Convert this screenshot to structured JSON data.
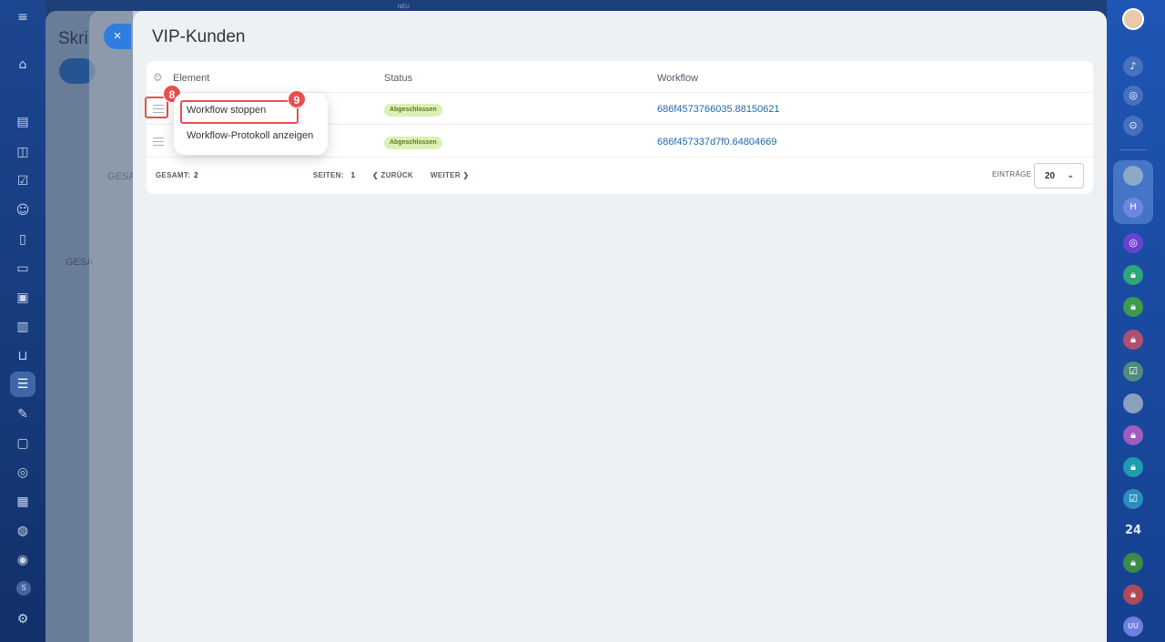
{
  "top_badge": "NEU",
  "left_sidebar": {
    "icons": [
      "menu-icon",
      "home-icon",
      "chat-icon",
      "feed-icon",
      "tasks-icon",
      "contacts-icon",
      "documents-icon",
      "inventory-icon",
      "projects-icon",
      "analytics-icon",
      "shop-icon",
      "automation-icon",
      "edit-icon",
      "cards-icon",
      "forms-icon",
      "calendar-icon",
      "bot-icon",
      "goals-icon",
      "user-initial-icon",
      "settings-icon"
    ],
    "user_initial": "S"
  },
  "background_layer_1": {
    "title": "Skri",
    "footer": "GESA"
  },
  "background_layer_2": {
    "footer": "GESA"
  },
  "close_button": "×",
  "slider": {
    "title": "VIP-Kunden",
    "table": {
      "columns": [
        "Element",
        "Status",
        "Workflow"
      ],
      "rows": [
        {
          "status": "Abgeschlossen",
          "workflow": "686f4573766035.88150621"
        },
        {
          "status": "Abgeschlossen",
          "workflow": "686f457337d7f0.64804669"
        }
      ]
    },
    "footer": {
      "total_label": "GESAMT:",
      "total_value": "2",
      "pages_label": "SEITEN:",
      "pages_value": "1",
      "back_label": "ZURÜCK",
      "next_label": "WEITER",
      "entries_label": "EINTRÄGE",
      "entries_value": "20"
    }
  },
  "context_menu": {
    "items": [
      "Workflow stoppen",
      "Workflow-Protokoll anzeigen"
    ]
  },
  "markers": {
    "handle": "8",
    "stop": "9"
  },
  "right_sidebar": {
    "counter": "24",
    "user_initials": [
      "H",
      "UU"
    ]
  },
  "colors": {
    "accent": "#2f7de1",
    "highlight": "#ea4e4e",
    "badge_bg": "#dcf0b6",
    "link": "#2066b0"
  }
}
